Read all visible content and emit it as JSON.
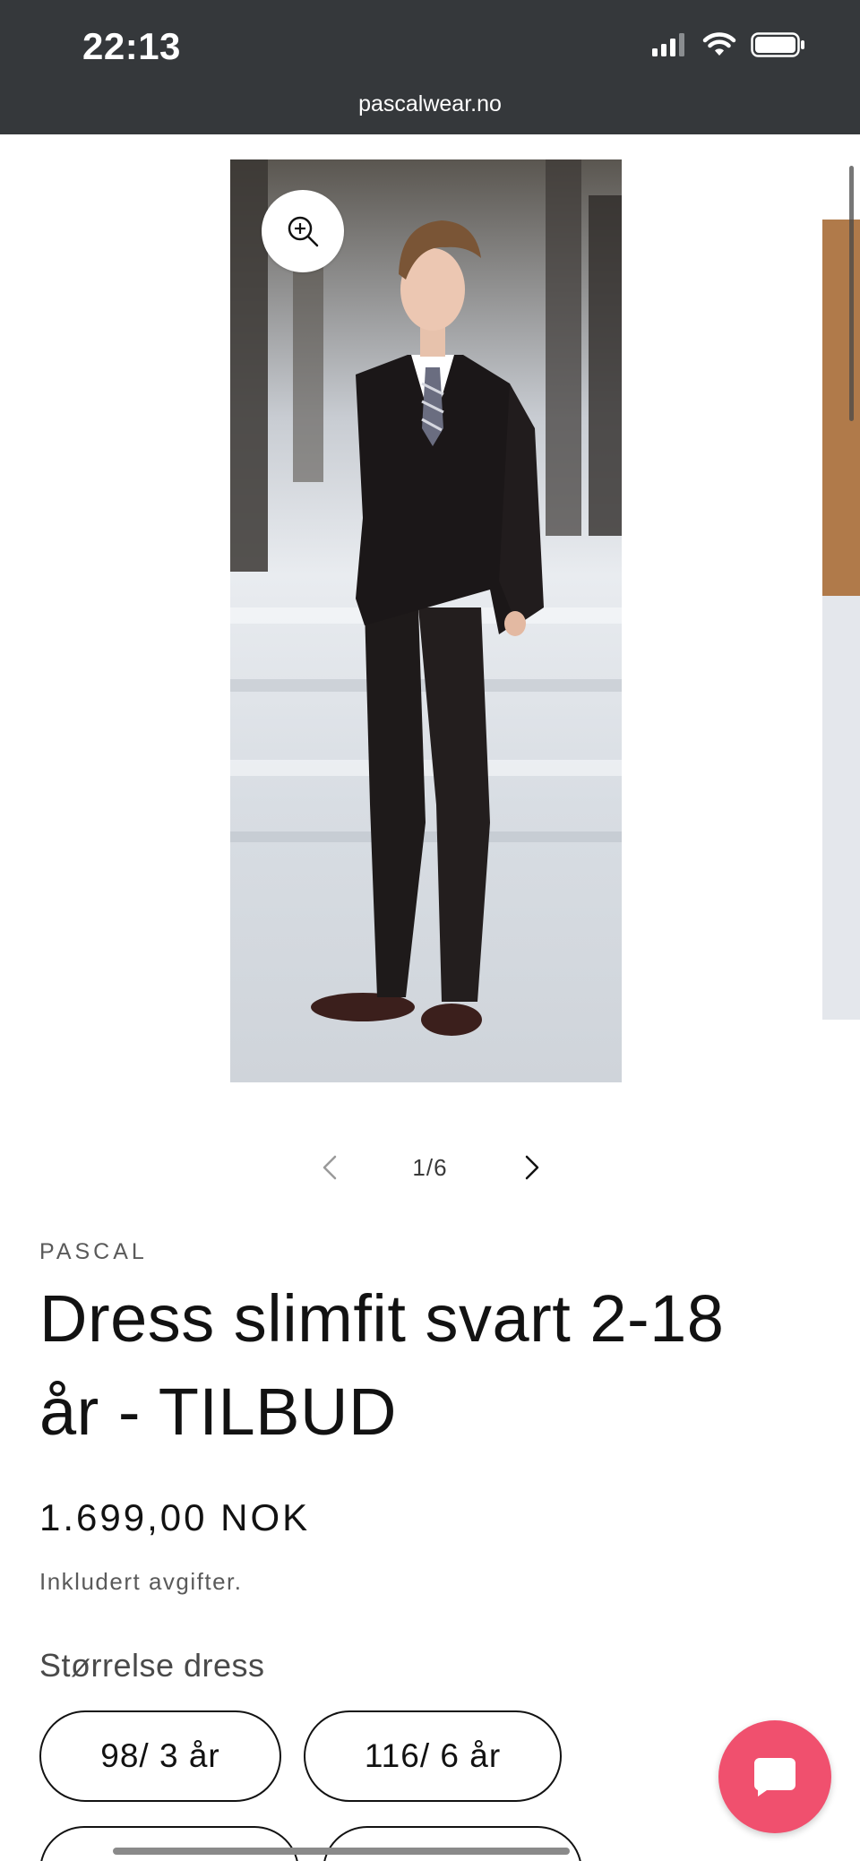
{
  "status_bar": {
    "time": "22:13"
  },
  "browser": {
    "url": "pascalwear.no"
  },
  "gallery": {
    "current": 1,
    "total": 6,
    "counter_text": "1/6",
    "icons": {
      "zoom": "zoom-in-icon",
      "prev": "chevron-left-icon",
      "next": "chevron-right-icon"
    }
  },
  "product": {
    "vendor": "PASCAL",
    "title": "Dress slimfit svart 2-18 år - TILBUD",
    "price": "1.699,00 NOK",
    "tax_note": "Inkludert avgifter.",
    "size_label": "Størrelse dress",
    "sizes": [
      "98/ 3 år",
      "116/ 6 år",
      "",
      ""
    ]
  },
  "chat": {
    "icon": "chat-bubble-icon",
    "color": "#f0506e"
  },
  "colors": {
    "topbar": "#35383b",
    "text": "#121212",
    "accent": "#f0506e"
  }
}
